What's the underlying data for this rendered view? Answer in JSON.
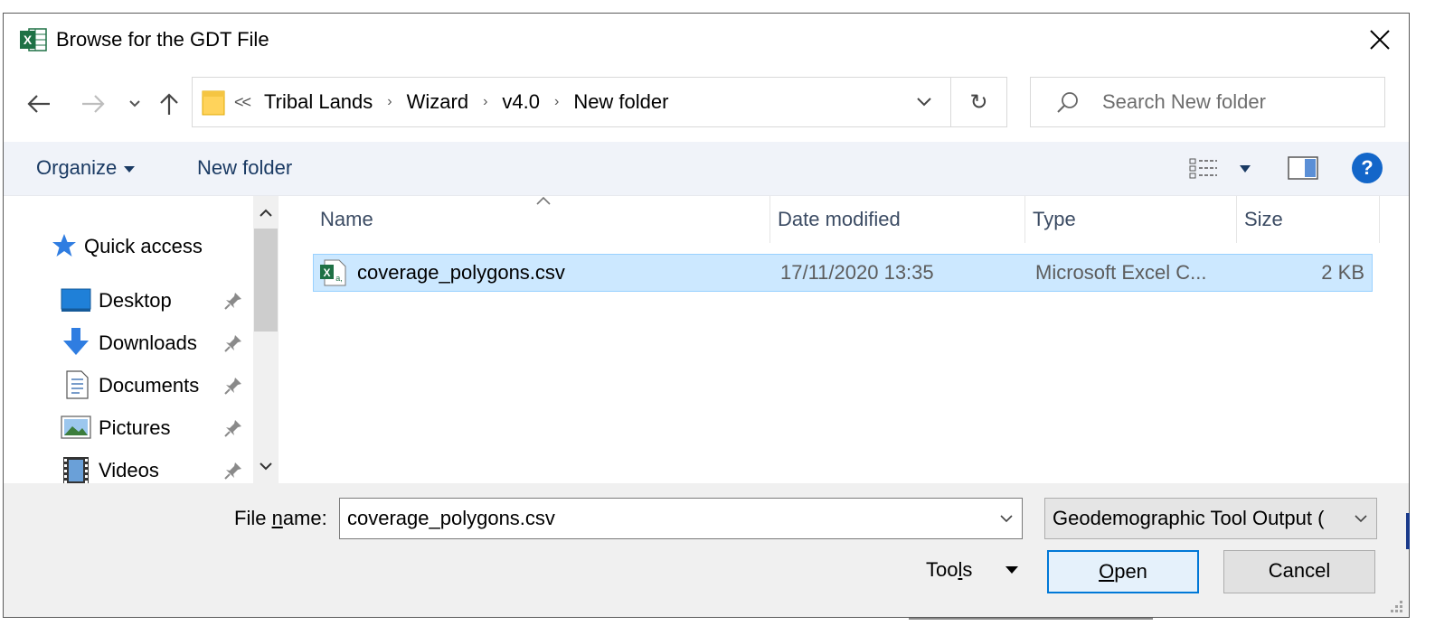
{
  "window": {
    "title": "Browse for the GDT File",
    "close_glyph": "✕"
  },
  "address_bar": {
    "overflow": "<<",
    "breadcrumbs": [
      "Tribal Lands",
      "Wizard",
      "v4.0",
      "New folder"
    ],
    "separator": "›",
    "refresh_glyph": "↻"
  },
  "search": {
    "placeholder": "Search New folder"
  },
  "toolbar": {
    "organize_label": "Organize",
    "new_folder_label": "New folder",
    "help_label": "?"
  },
  "nav_pane": {
    "items": [
      {
        "label": "Quick access",
        "icon": "star-icon"
      },
      {
        "label": "Desktop",
        "icon": "desktop-icon",
        "pinned": true
      },
      {
        "label": "Downloads",
        "icon": "download-arrow-icon",
        "pinned": true
      },
      {
        "label": "Documents",
        "icon": "document-icon",
        "pinned": true
      },
      {
        "label": "Pictures",
        "icon": "pictures-icon",
        "pinned": true
      },
      {
        "label": "Videos",
        "icon": "film-icon",
        "pinned": true
      }
    ]
  },
  "file_list": {
    "columns": [
      "Name",
      "Date modified",
      "Type",
      "Size"
    ],
    "rows": [
      {
        "name": "coverage_polygons.csv",
        "date_modified": "17/11/2020 13:35",
        "type": "Microsoft Excel C...",
        "size": "2 KB",
        "selected": true
      }
    ]
  },
  "bottom": {
    "file_name_label_pre": "File ",
    "file_name_label_ul": "n",
    "file_name_label_post": "ame:",
    "file_name_value": "coverage_polygons.csv",
    "file_type_value": "Geodemographic Tool Output (",
    "tools_label_pre": "Too",
    "tools_label_ul": "l",
    "tools_label_post": "s",
    "open_label_ul": "O",
    "open_label_post": "pen",
    "cancel_label": "Cancel"
  },
  "colors": {
    "selection_bg": "#cce8ff",
    "selection_border": "#99d1ff",
    "command_bar_bg": "#f0f3f9",
    "accent": "#0078d7",
    "excel_green": "#1e7145"
  }
}
